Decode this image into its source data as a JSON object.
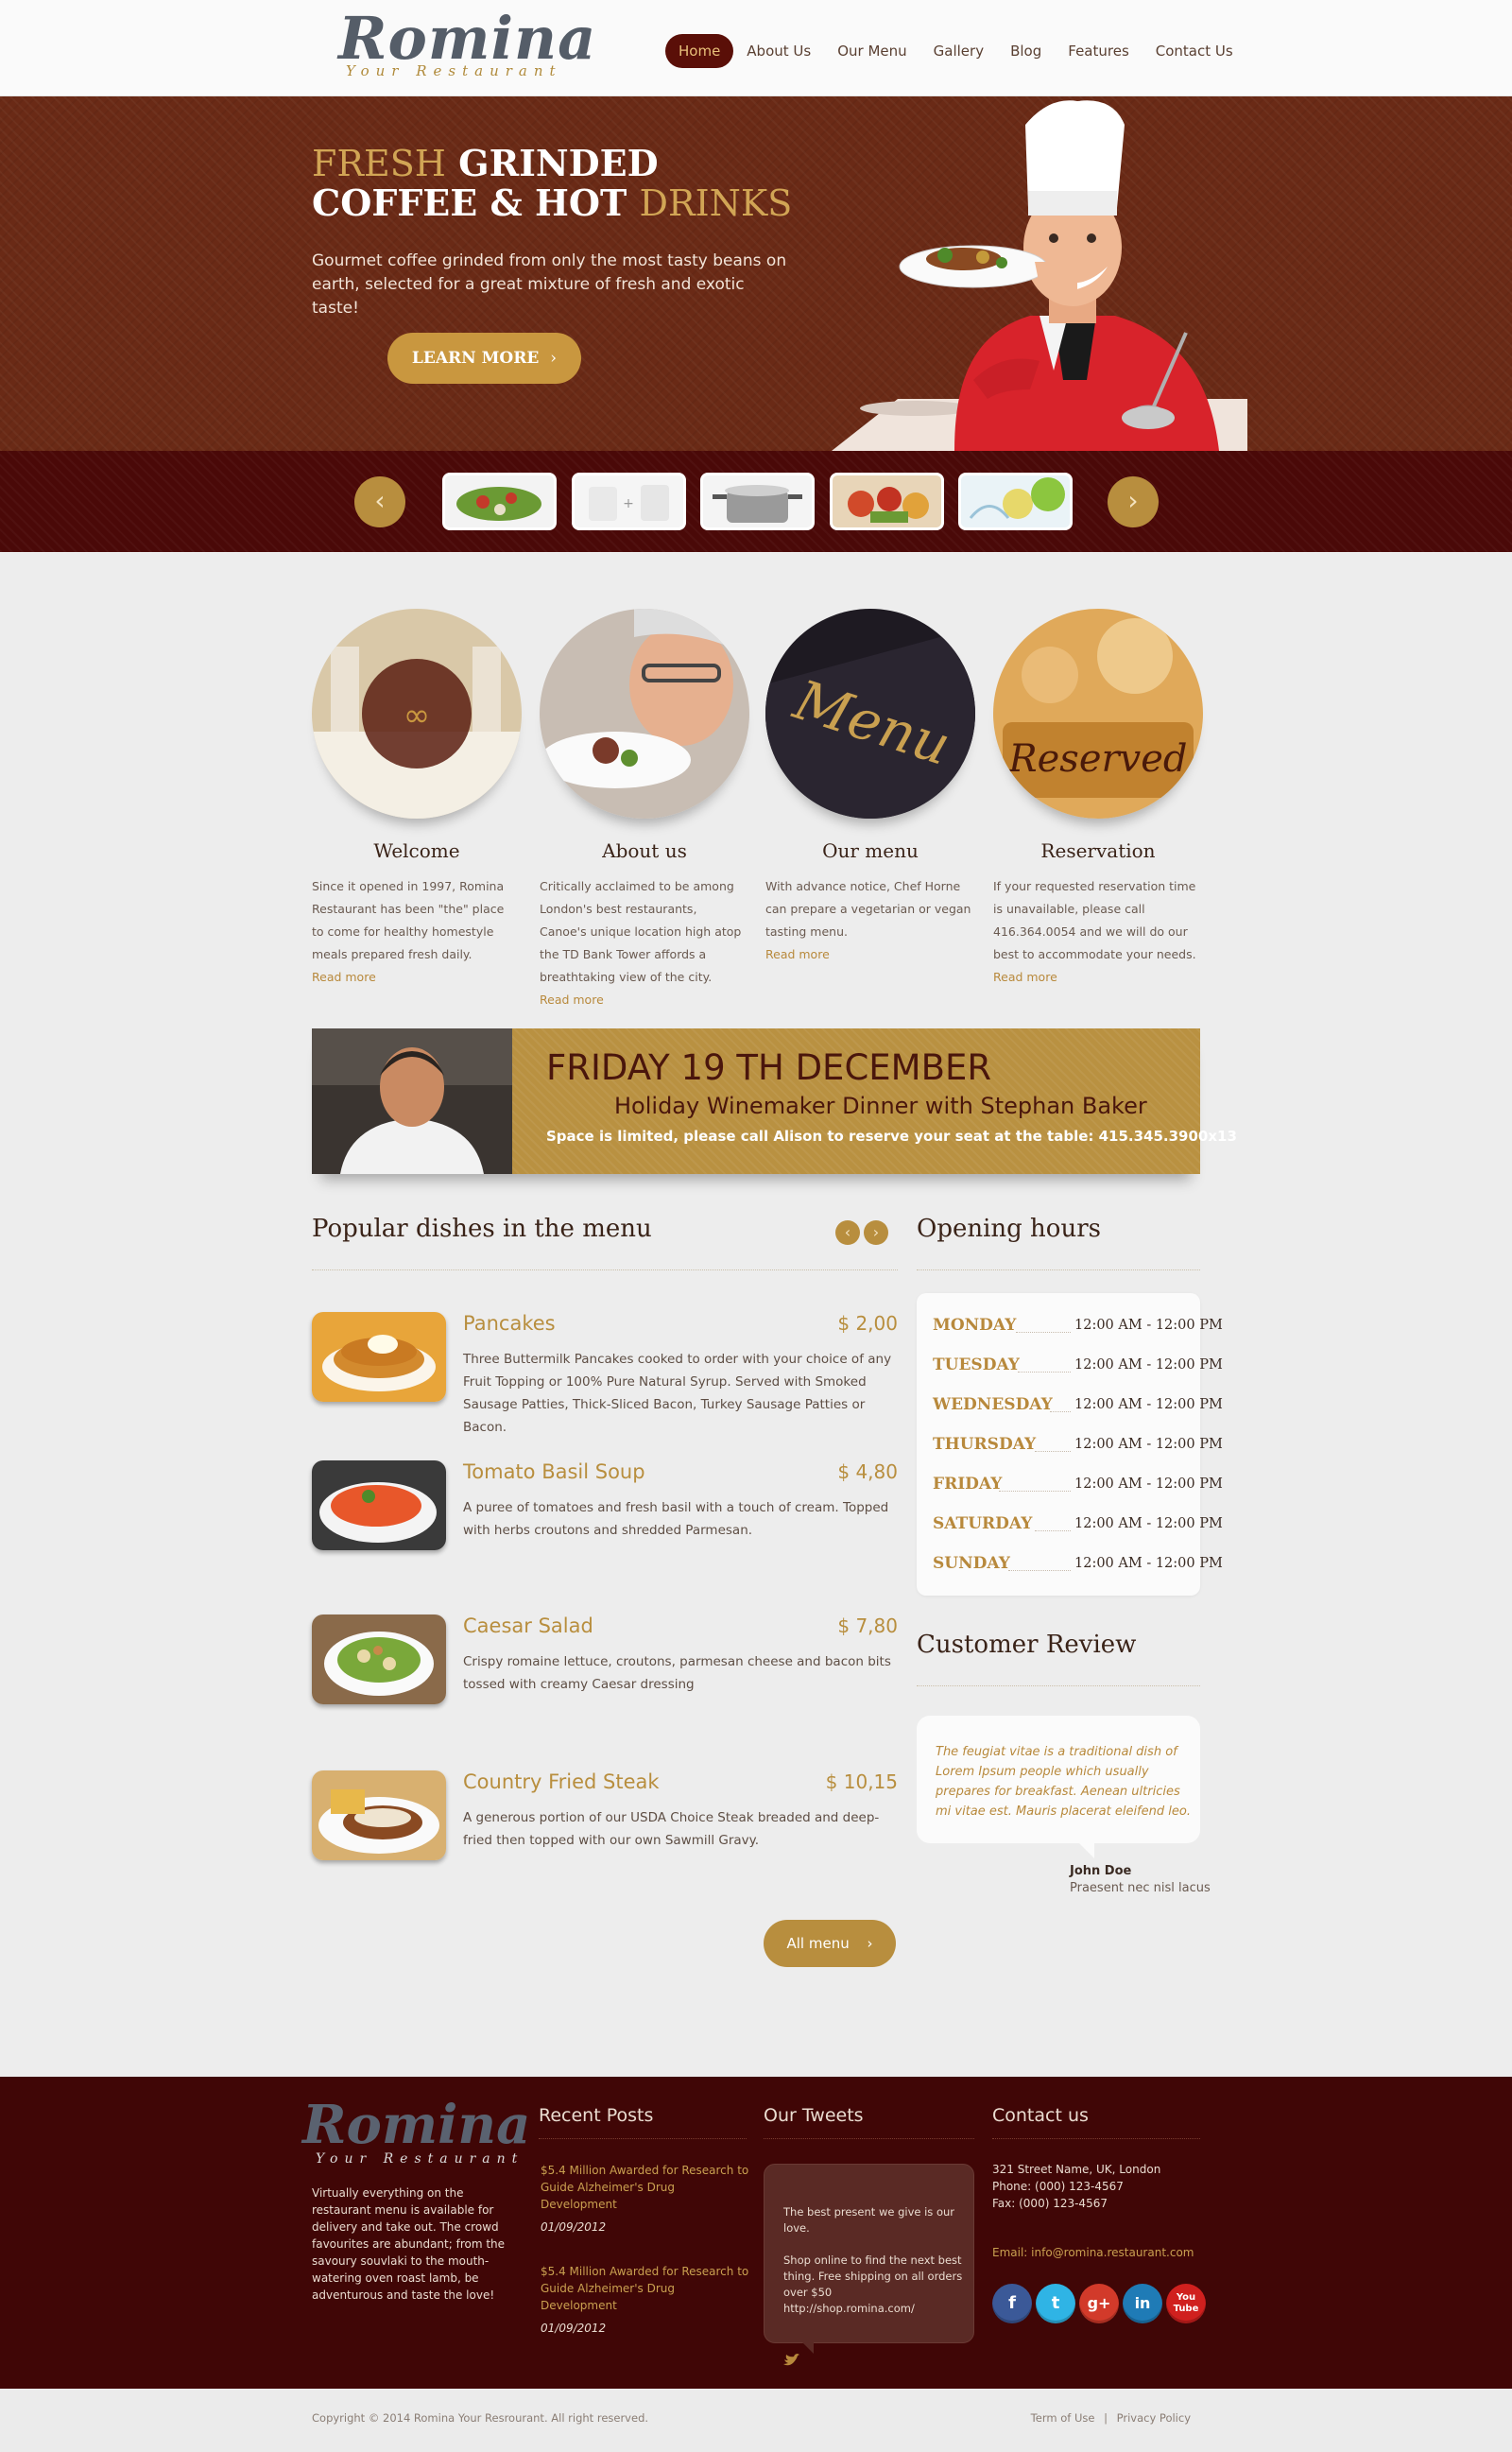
{
  "header": {
    "logo_name": "Romina",
    "logo_tagline": "Your Restaurant",
    "nav": [
      "Home",
      "About Us",
      "Our Menu",
      "Gallery",
      "Blog",
      "Features",
      "Contact Us"
    ],
    "active_nav": "Home"
  },
  "hero": {
    "title_line1_gold": "FRESH",
    "title_line1_white": "GRINDED",
    "title_line2_white": "COFFEE & HOT",
    "title_line2_gold": "DRINKS",
    "subtitle": "Gourmet coffee grinded from only the most tasty beans on earth, selected for a great mixture of fresh and exotic taste!",
    "button": "LEARN MORE",
    "button_arrow": "›"
  },
  "slider": {
    "prev": "‹",
    "next": "›",
    "thumbs": [
      "salad-thumb",
      "kitchenware-thumb",
      "cooking-pot-thumb",
      "vegetables-thumb",
      "lime-water-thumb"
    ]
  },
  "features": [
    {
      "title": "Welcome",
      "text": "Since it opened in 1997, Romina Restaurant has been \"the\" place to come for healthy homestyle meals prepared fresh daily.",
      "more": "Read more"
    },
    {
      "title": "About us",
      "text": "Critically acclaimed to be among London's best restaurants, Canoe's unique location high atop the TD Bank Tower affords a breathtaking view of the city.",
      "more": "Read more"
    },
    {
      "title": "Our menu",
      "text": "With advance notice, Chef Horne can prepare a vegetarian or vegan tasting menu.",
      "more": "Read more",
      "image_text": "Menu"
    },
    {
      "title": "Reservation",
      "text": "If your requested reservation time is unavailable, please call 416.364.0054 and we will do our best to accommodate your needs.",
      "more": "Read more",
      "image_text": "Reserved"
    }
  ],
  "event": {
    "date": "FRIDAY 19 TH DECEMBER",
    "title": "Holiday Winemaker Dinner with Stephan Baker",
    "info": "Space is limited, please call Alison to reserve your seat at the table: 415.345.3900x13"
  },
  "popular": {
    "heading": "Popular dishes in the menu",
    "prev": "‹",
    "next": "›",
    "dishes": [
      {
        "name": "Pancakes",
        "price": "$ 2,00",
        "desc": "Three Buttermilk Pancakes  cooked to order with your choice of any Fruit Topping or 100% Pure Natural Syrup. Served with Smoked Sausage Patties, Thick-Sliced Bacon, Turkey Sausage Patties or Bacon."
      },
      {
        "name": "Tomato Basil Soup",
        "price": "$ 4,80",
        "desc": "A puree of tomatoes and fresh basil with a touch of cream. Topped with herbs croutons and shredded Parmesan."
      },
      {
        "name": "Caesar Salad",
        "price": "$ 7,80",
        "desc": "Crispy romaine lettuce, croutons, parmesan cheese and bacon bits tossed with creamy Caesar dressing"
      },
      {
        "name": "Country Fried Steak",
        "price": "$ 10,15",
        "desc": "A generous portion of our USDA Choice Steak breaded and deep-fried then topped with our own Sawmill Gravy."
      }
    ],
    "all_menu": "All menu",
    "all_menu_arrow": "›"
  },
  "hours": {
    "heading": "Opening hours",
    "rows": [
      {
        "day": "MONDAY",
        "time": "12:00 AM - 12:00 PM"
      },
      {
        "day": "TUESDAY",
        "time": "12:00 AM - 12:00 PM"
      },
      {
        "day": "WEDNESDAY",
        "time": "12:00 AM - 12:00 PM"
      },
      {
        "day": "THURSDAY",
        "time": "12:00 AM - 12:00 PM"
      },
      {
        "day": "FRIDAY",
        "time": "12:00 AM - 12:00 PM"
      },
      {
        "day": "SATURDAY",
        "time": "12:00 AM - 12:00 PM"
      },
      {
        "day": "SUNDAY",
        "time": "12:00 AM - 12:00 PM"
      }
    ]
  },
  "review": {
    "heading": "Customer Review",
    "text": "The feugiat vitae is a traditional dish of Lorem Ipsum people which usually prepares for breakfast. Aenean ultricies mi vitae est. Mauris placerat eleifend leo.",
    "name": "John Doe",
    "role": "Praesent nec nisl lacus"
  },
  "footer": {
    "logo_name": "Romina",
    "logo_tagline": "Your Restaurant",
    "about": "Virtually everything on the restaurant menu is available for delivery and take out. The crowd favourites are abundant; from the savoury souvlaki to the mouth-watering oven roast lamb, be adventurous and taste the love!",
    "recent_posts_heading": "Recent Posts",
    "posts": [
      {
        "title": "$5.4 Million Awarded for Research to Guide Alzheimer's Drug Development",
        "date": "01/09/2012"
      },
      {
        "title": "$5.4 Million Awarded for Research to Guide Alzheimer's Drug Development",
        "date": "01/09/2012"
      }
    ],
    "tweets_heading": "Our Tweets",
    "tweet": "The best present we give is our love.\n\nShop online to find the next best thing. Free shipping on all orders over $50 http://shop.romina.com/",
    "contact_heading": "Contact us",
    "address": "321 Street Name, UK, London",
    "phone": "Phone: (000) 123-4567",
    "fax": "Fax: (000) 123-4567",
    "email": "Email: info@romina.restaurant.com",
    "social": [
      {
        "label": "f",
        "color": "#3b5998"
      },
      {
        "label": "t",
        "color": "#2fb4e5"
      },
      {
        "label": "g+",
        "color": "#d23a2a"
      },
      {
        "label": "in",
        "color": "#1f7bb6"
      },
      {
        "label": "You Tube",
        "color": "#d0201e"
      }
    ]
  },
  "bottom": {
    "copyright": "Copyright © 2014 Romina Your Resrourant. All right reserved.",
    "terms": "Term of Use",
    "sep": "|",
    "privacy": "Privacy Policy"
  },
  "colors": {
    "brown_dark": "#400606",
    "gold": "#b88e3e",
    "hero_brown": "#6a2a16"
  }
}
